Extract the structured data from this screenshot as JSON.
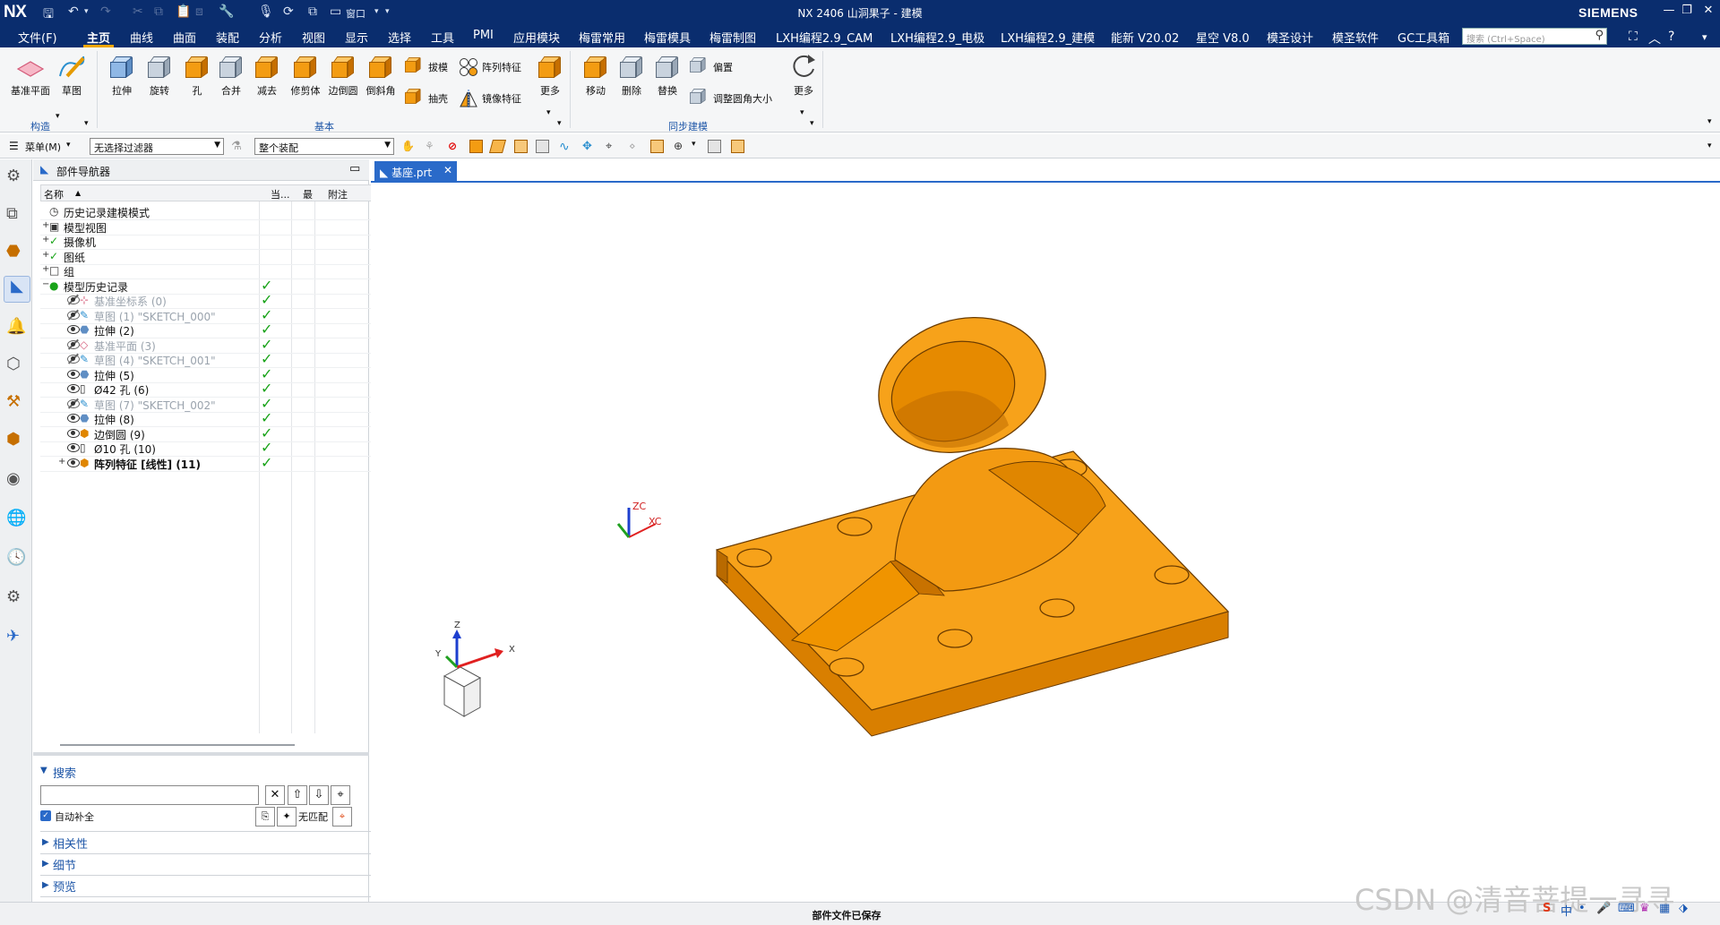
{
  "window": {
    "logo": "NX",
    "title": "NX 2406 山洞果子 - 建模",
    "brand": "SIEMENS",
    "quick_access": {
      "window_label": "窗口"
    }
  },
  "menubar": {
    "items": [
      "文件(F)",
      "主页",
      "曲线",
      "曲面",
      "装配",
      "分析",
      "视图",
      "显示",
      "选择",
      "工具",
      "PMI",
      "应用模块",
      "梅雷常用",
      "梅雷模具",
      "梅雷制图",
      "LXH编程2.9_CAM",
      "LXH编程2.9_电极",
      "LXH编程2.9_建模",
      "能新 V20.02",
      "星空 V8.0",
      "模圣设计",
      "模圣软件",
      "GC工具箱"
    ],
    "active": "主页",
    "search_placeholder": "搜索 (Ctrl+Space)"
  },
  "ribbon": {
    "construct": {
      "label": "构造",
      "buttons": [
        "基准平面",
        "草图"
      ]
    },
    "basic": {
      "label": "基本",
      "buttons": [
        "拉伸",
        "旋转",
        "孔",
        "合并",
        "减去",
        "修剪体",
        "边倒圆",
        "倒斜角"
      ],
      "small": [
        "拔模",
        "阵列特征",
        "抽壳",
        "镜像特征"
      ],
      "more": "更多"
    },
    "sync": {
      "label": "同步建模",
      "buttons": [
        "移动",
        "删除",
        "替换"
      ],
      "small": [
        "偏置",
        "调整圆角大小"
      ],
      "more": "更多"
    }
  },
  "toolbar2": {
    "menu_label": "菜单(M)",
    "filter_value": "无选择过滤器",
    "scope_value": "整个装配"
  },
  "navigator": {
    "title": "部件导航器",
    "columns": [
      "名称",
      "当...",
      "最",
      "附注"
    ],
    "rows": [
      {
        "label": "历史记录建模模式",
        "indent": 0,
        "expander": "",
        "state": "normal",
        "check": false,
        "icon": "clock-icon"
      },
      {
        "label": "模型视图",
        "indent": 0,
        "expander": "+",
        "state": "normal",
        "check": false,
        "icon": "model-view-icon"
      },
      {
        "label": "摄像机",
        "indent": 0,
        "expander": "+",
        "state": "normal",
        "check": false,
        "icon": "camera-icon"
      },
      {
        "label": "图纸",
        "indent": 0,
        "expander": "+",
        "state": "normal",
        "check": false,
        "icon": "drawing-icon"
      },
      {
        "label": "组",
        "indent": 0,
        "expander": "+",
        "state": "normal",
        "check": false,
        "icon": "group-icon"
      },
      {
        "label": "模型历史记录",
        "indent": 0,
        "expander": "−",
        "state": "normal",
        "check": true,
        "icon": "history-icon"
      },
      {
        "label": "基准坐标系 (0)",
        "indent": 1,
        "expander": "",
        "state": "dim",
        "check": true,
        "icon": "csys-icon"
      },
      {
        "label": "草图 (1) \"SKETCH_000\"",
        "indent": 1,
        "expander": "",
        "state": "dim",
        "check": true,
        "icon": "sketch-icon"
      },
      {
        "label": "拉伸 (2)",
        "indent": 1,
        "expander": "",
        "state": "normal",
        "check": true,
        "icon": "extrude-icon"
      },
      {
        "label": "基准平面 (3)",
        "indent": 1,
        "expander": "",
        "state": "dim",
        "check": true,
        "icon": "datum-plane-icon"
      },
      {
        "label": "草图 (4) \"SKETCH_001\"",
        "indent": 1,
        "expander": "",
        "state": "dim",
        "check": true,
        "icon": "sketch-icon"
      },
      {
        "label": "拉伸 (5)",
        "indent": 1,
        "expander": "",
        "state": "normal",
        "check": true,
        "icon": "extrude-icon"
      },
      {
        "label": "Ø42 孔 (6)",
        "indent": 1,
        "expander": "",
        "state": "normal",
        "check": true,
        "icon": "hole-icon"
      },
      {
        "label": "草图 (7) \"SKETCH_002\"",
        "indent": 1,
        "expander": "",
        "state": "dim",
        "check": true,
        "icon": "sketch-icon"
      },
      {
        "label": "拉伸 (8)",
        "indent": 1,
        "expander": "",
        "state": "normal",
        "check": true,
        "icon": "extrude-icon"
      },
      {
        "label": "边倒圆 (9)",
        "indent": 1,
        "expander": "",
        "state": "normal",
        "check": true,
        "icon": "blend-icon"
      },
      {
        "label": "Ø10 孔 (10)",
        "indent": 1,
        "expander": "",
        "state": "normal",
        "check": true,
        "icon": "hole-icon"
      },
      {
        "label": "阵列特征 [线性] (11)",
        "indent": 1,
        "expander": "+",
        "state": "bold",
        "check": true,
        "icon": "pattern-icon"
      }
    ],
    "search": {
      "title": "搜索",
      "value": "",
      "auto_complete": "自动补全",
      "no_match": "无匹配"
    },
    "sections": [
      "相关性",
      "细节",
      "预览"
    ]
  },
  "document": {
    "tab": "基座.prt"
  },
  "viewport": {
    "wcs": {
      "z": "ZC",
      "x": "XC"
    },
    "triad": {
      "x": "X",
      "y": "Y",
      "z": "Z"
    }
  },
  "status": {
    "message": "部件文件已保存"
  },
  "watermark": "CSDN @清音菩提一寻寻",
  "colors": {
    "title_bg": "#0a2d6e",
    "accent": "#2a6ac9",
    "part": "#f7a21a",
    "check": "#19a319"
  }
}
